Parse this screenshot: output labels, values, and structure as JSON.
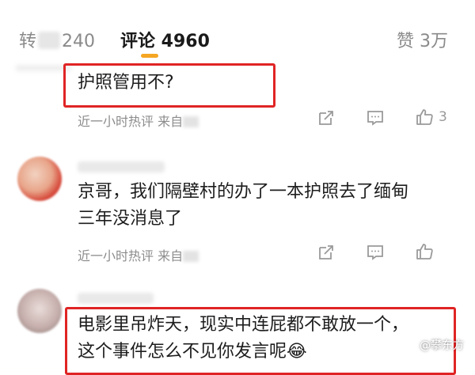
{
  "tabs": {
    "repost_prefix": "转",
    "repost_count": "240",
    "comments_label": "评论 4960",
    "likes_label": "赞 3万"
  },
  "comments": [
    {
      "text_lines": [
        "护照管用不?"
      ],
      "meta": "近一小时热评  来自",
      "like_count": "3"
    },
    {
      "text_lines": [
        "京哥，我们隔壁村的办了一本护照去了缅甸",
        "三年没消息了"
      ],
      "meta": "近一小时热评  来自",
      "like_count": ""
    },
    {
      "text_lines": [
        "电影里吊炸天，现实中连屁都不敢放一个，",
        "这个事件怎么不见你发言呢😂"
      ],
      "meta": "",
      "like_count": ""
    }
  ],
  "watermark": {
    "text": "@攀东方"
  },
  "colors": {
    "accent": "#f5a623",
    "highlight": "#e02424"
  }
}
